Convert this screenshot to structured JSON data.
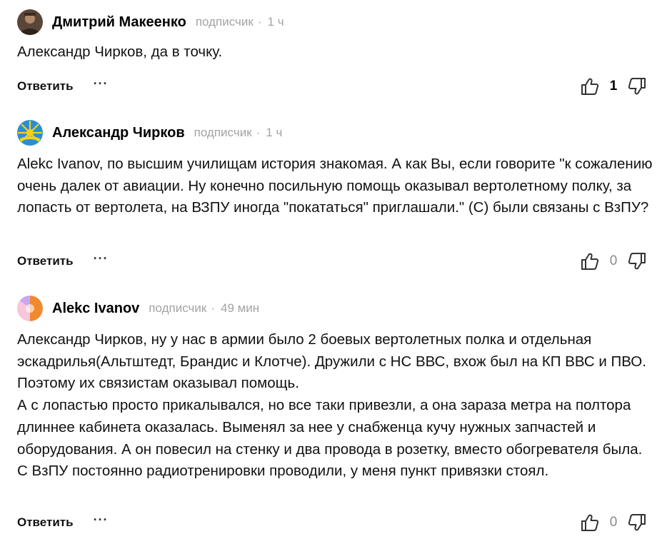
{
  "comments": [
    {
      "author": "Дмитрий Макеенко",
      "role": "подписчик",
      "time": "1 ч",
      "text": [
        "Александр Чирков, да в точку."
      ],
      "reply_label": "Ответить",
      "more_label": "···",
      "likes": "1"
    },
    {
      "author": "Александр Чирков",
      "role": "подписчик",
      "time": "1 ч",
      "text": [
        "Alekc Ivanov, по высшим училищам история знакомая. А как Вы, если говорите \"к сожалению очень далек от авиации. Ну конечно посильную помощь оказывал вертолетному полку, за лопасть от вертолета, на ВЗПУ иногда \"покататься\" приглашали.\" (С) были связаны с ВзПУ?"
      ],
      "reply_label": "Ответить",
      "more_label": "···",
      "likes": "0"
    },
    {
      "author": "Alekc Ivanov",
      "role": "подписчик",
      "time": "49 мин",
      "text": [
        "Александр Чирков, ну у нас в армии было 2 боевых вертолетных полка и отдельная эскадрилья(Альтштедт, Брандис и Клотче). Дружили с НС ВВС, вхож был на КП ВВС и ПВО. Поэтому их связистам оказывал помощь.",
        "А с лопастью просто прикалывался, но все таки привезли, а она зараза метра на полтора длиннее кабинета оказалась. Выменял за нее у снабженца кучу нужных запчастей и оборудования. А он повесил на стенку и два провода в розетку, вместо обогревателя была.",
        "С  ВзПУ постоянно радиотренировки проводили, у меня пункт привязки стоял."
      ],
      "reply_label": "Ответить",
      "more_label": "···",
      "likes": "0"
    }
  ],
  "icons": {
    "like": "thumbs-up-icon",
    "dislike": "thumbs-down-icon"
  },
  "colors": {
    "meta": "#a3a3a3",
    "icon": "#333333"
  }
}
